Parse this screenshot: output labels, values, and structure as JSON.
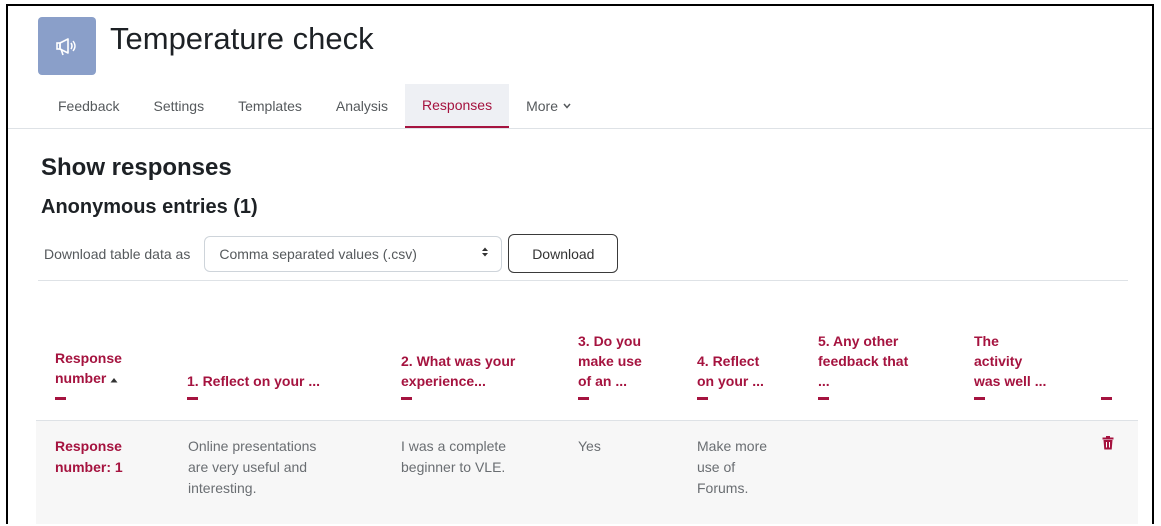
{
  "header": {
    "title": "Temperature check",
    "icon": "megaphone-icon",
    "icon_bg": "#8a9fc9"
  },
  "tabs": [
    {
      "label": "Feedback"
    },
    {
      "label": "Settings"
    },
    {
      "label": "Templates"
    },
    {
      "label": "Analysis"
    },
    {
      "label": "Responses",
      "active": true
    },
    {
      "label": "More",
      "icon": "chevron-down-icon"
    }
  ],
  "headings": {
    "show_responses": "Show responses",
    "anonymous_entries": "Anonymous entries (1)"
  },
  "download": {
    "label": "Download table data as",
    "format_selected": "Comma separated values (.csv)",
    "button_label": "Download"
  },
  "table": {
    "columns": [
      {
        "lines": [
          "Response",
          "number"
        ],
        "sorted": "ascending"
      },
      {
        "lines": [
          "1. Reflect on your ..."
        ]
      },
      {
        "lines": [
          "2. What was your",
          "experience..."
        ]
      },
      {
        "lines": [
          "3. Do you",
          "make use",
          "of an ..."
        ]
      },
      {
        "lines": [
          "4. Reflect",
          "on your ..."
        ]
      },
      {
        "lines": [
          "5. Any other",
          "feedback that",
          "..."
        ]
      },
      {
        "lines": [
          "The",
          "activity",
          "was well ..."
        ]
      },
      {
        "lines": []
      }
    ],
    "rows": [
      {
        "response_number": [
          "Response",
          "number: 1"
        ],
        "cells": [
          [
            "Online presentations",
            "are very useful and",
            "interesting."
          ],
          [
            "I was a complete",
            "beginner to VLE."
          ],
          [
            "Yes"
          ],
          [
            "Make more",
            "use of",
            "Forums."
          ],
          [],
          []
        ],
        "action_icon": "trash-icon"
      }
    ]
  },
  "colors": {
    "accent": "#a5133f",
    "muted_text": "#55595c",
    "row_bg": "#f7f7f7"
  }
}
